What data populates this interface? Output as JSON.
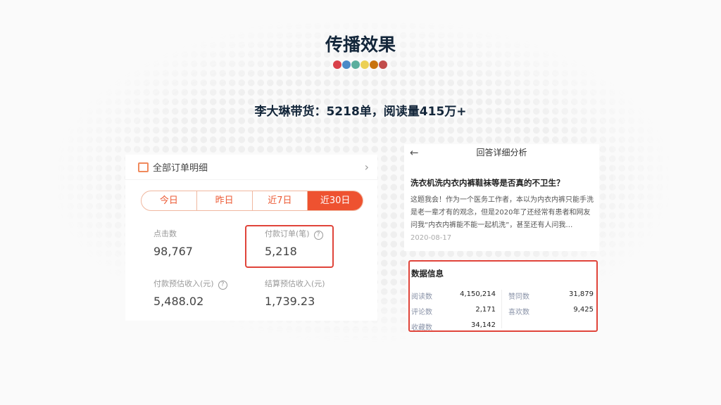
{
  "title": "传播效果",
  "dot_colors": [
    "#d9414a",
    "#4a8ac8",
    "#5aae9e",
    "#ecd055",
    "#c8730e",
    "#c24d4c"
  ],
  "subtitle": "李大琳带货：5218单，阅读量415万+",
  "orders": {
    "header": "全部订单明细",
    "tabs": [
      "今日",
      "昨日",
      "近7日",
      "近30日"
    ],
    "active_tab": "近30日",
    "metrics": [
      {
        "label": "点击数",
        "value": "98,767"
      },
      {
        "label": "付款订单(笔)",
        "value": "5,218"
      },
      {
        "label": "付款预估收入(元)",
        "value": "5,488.02"
      },
      {
        "label": "结算预估收入(元)",
        "value": "1,739.23"
      }
    ]
  },
  "answer": {
    "header": "回答详细分析",
    "question": "洗衣机洗内衣内裤鞋袜等是否真的不卫生？",
    "excerpt": "这题我会！作为一个医务工作者，本以为内衣内裤只能手洗是老一辈才有的观念，但是2020年了还经常有患者和网友问我“内衣内裤能不能一起机洗”，甚至还有人问我…",
    "date": "2020-08-17"
  },
  "stats": {
    "header": "数据信息",
    "items": [
      {
        "label": "阅读数",
        "value": "4,150,214"
      },
      {
        "label": "赞同数",
        "value": "31,879"
      },
      {
        "label": "评论数",
        "value": "2,171"
      },
      {
        "label": "喜欢数",
        "value": "9,425"
      },
      {
        "label": "收藏数",
        "value": "34,142"
      }
    ]
  }
}
